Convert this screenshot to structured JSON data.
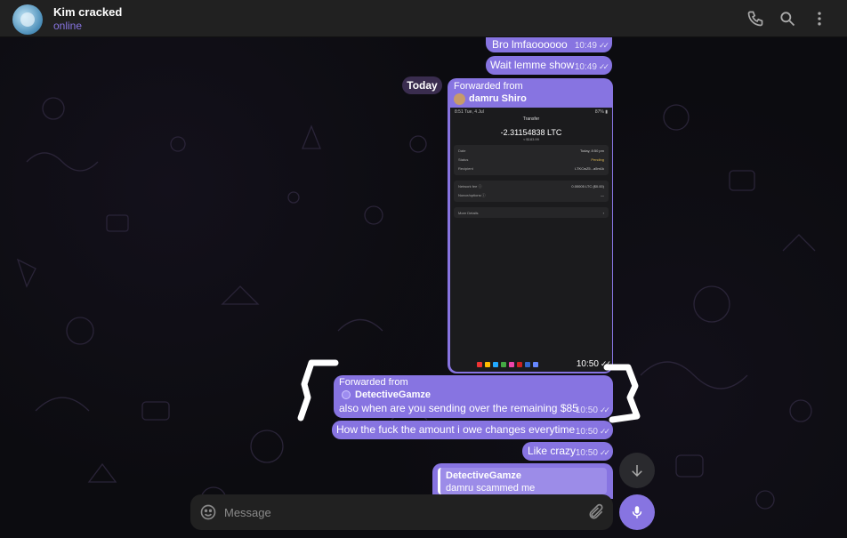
{
  "header": {
    "title": "Kim cracked",
    "status": "online",
    "icons": [
      "phone-icon",
      "search-icon",
      "more-icon"
    ]
  },
  "chat": {
    "date_label": "Today",
    "messages": [
      {
        "text": "Bro lmfaoooooo",
        "time": "10:49"
      },
      {
        "text": "Wait lemme show",
        "time": "10:49"
      },
      {
        "forwarded_label": "Forwarded from",
        "forwarded_from": "damru Shiro",
        "time": "10:50",
        "screenshot": {
          "status_left": "8:51  Tue, 4 Jul",
          "status_right": "87% ▮",
          "title": "Transfer",
          "amount": "-2.31154838 LTC",
          "amount_fiat": "≈ $183.99",
          "rows_top": [
            {
              "label": "Date",
              "value": "Today, 8:50 pm"
            },
            {
              "label": "Status",
              "value": "Pending"
            },
            {
              "label": "Recipient",
              "value": "LTKCwZ5...a5m1k"
            }
          ],
          "rows_mid": [
            {
              "label": "Network fee ⓘ",
              "value": "0.00005 LTC ($0.00)"
            },
            {
              "label": "Nonce/options ⓘ",
              "value": "—"
            }
          ],
          "rows_bot": [
            {
              "label": "More Details",
              "value": "›"
            }
          ]
        }
      },
      {
        "forwarded_label": "Forwarded from",
        "forwarded_from": "DetectiveGamze",
        "text": "also when are you sending over the remaining $85",
        "time": "10:50"
      },
      {
        "text": "How the fuck the amount i owe changes everytime",
        "time": "10:50"
      },
      {
        "text": "Like crazy",
        "time": "10:50"
      },
      {
        "reply_name": "DetectiveGamze",
        "reply_text": "damru scammed me"
      }
    ]
  },
  "composer": {
    "placeholder": "Message"
  },
  "colors": {
    "accent": "#8774e1",
    "header_bg": "#212121",
    "chat_bg": "#0c0c10"
  }
}
